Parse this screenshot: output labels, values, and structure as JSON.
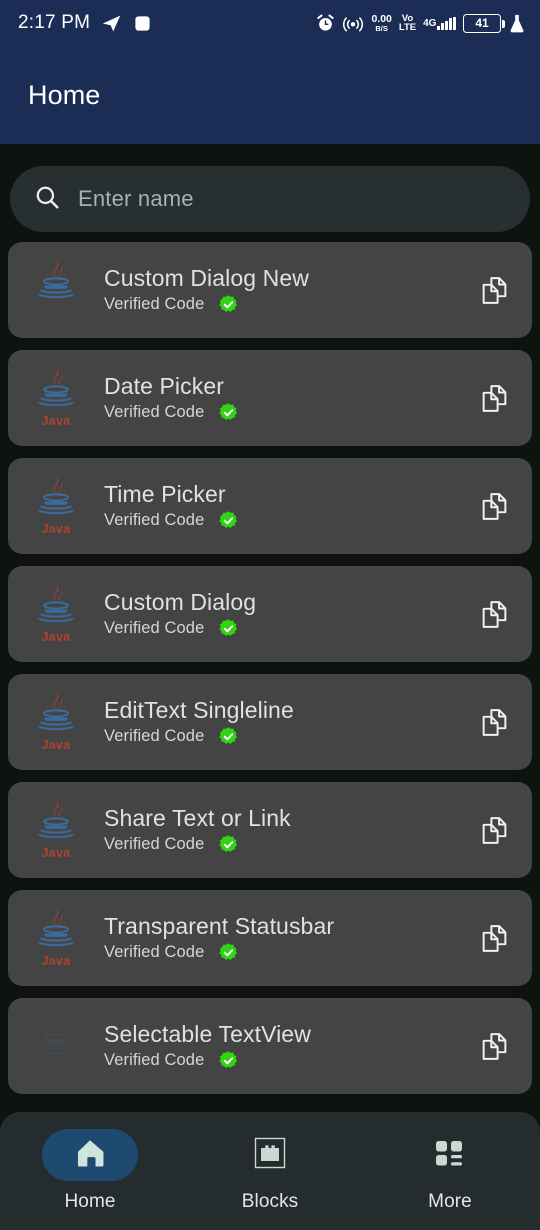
{
  "statusbar": {
    "time": "2:17 PM",
    "icons_left": [
      "telegram-icon",
      "stop-square-icon"
    ],
    "alarm_icon": "alarm-clock-icon",
    "hotspot_icon": "wifi-signal-icon",
    "net_speed_value": "0.00",
    "net_speed_unit": "B/S",
    "volte_top": "Vo",
    "volte_bottom": "LTE",
    "network_type": "4G",
    "battery_level": "41",
    "lab_icon": "flask-icon",
    "bg_color": "#1b2d55"
  },
  "appbar": {
    "title": "Home",
    "bg_color": "#1b2d55"
  },
  "search": {
    "icon": "search-icon",
    "placeholder": "Enter name",
    "value": ""
  },
  "list": {
    "verified_label": "Verified Code",
    "copy_icon": "copy-documents-icon",
    "verified_icon": "verified-badge-icon",
    "language_icon": "java-logo-icon",
    "language_label": "Java",
    "items": [
      {
        "title": "Custom Dialog New",
        "status": "Verified Code",
        "lang": "Java",
        "lang_label_visible": false,
        "logo_faded": false
      },
      {
        "title": "Date Picker",
        "status": "Verified Code",
        "lang": "Java",
        "lang_label_visible": true,
        "logo_faded": false
      },
      {
        "title": "Time Picker",
        "status": "Verified Code",
        "lang": "Java",
        "lang_label_visible": true,
        "logo_faded": false
      },
      {
        "title": "Custom Dialog",
        "status": "Verified Code",
        "lang": "Java",
        "lang_label_visible": true,
        "logo_faded": false
      },
      {
        "title": "EditText Singleline",
        "status": "Verified Code",
        "lang": "Java",
        "lang_label_visible": true,
        "logo_faded": false
      },
      {
        "title": "Share Text or Link",
        "status": "Verified Code",
        "lang": "Java",
        "lang_label_visible": true,
        "logo_faded": false
      },
      {
        "title": "Transparent Statusbar",
        "status": "Verified Code",
        "lang": "Java",
        "lang_label_visible": true,
        "logo_faded": false
      },
      {
        "title": "Selectable TextView",
        "status": "Verified Code",
        "lang": "Java",
        "lang_label_visible": false,
        "logo_faded": true
      }
    ]
  },
  "bottomnav": {
    "bg_color": "#242c2e",
    "active_pill_color": "#1d4a70",
    "items": [
      {
        "label": "Home",
        "icon": "home-icon",
        "active": true
      },
      {
        "label": "Blocks",
        "icon": "blocks-icon",
        "active": false
      },
      {
        "label": "More",
        "icon": "dashboard-icon",
        "active": false
      }
    ]
  },
  "colors": {
    "page_bg": "#0d130e",
    "card_bg": "#444444",
    "search_bg": "#272f31",
    "verified_green": "#2fd413",
    "java_red": "#c8402e",
    "java_blue": "#3a74b0"
  }
}
